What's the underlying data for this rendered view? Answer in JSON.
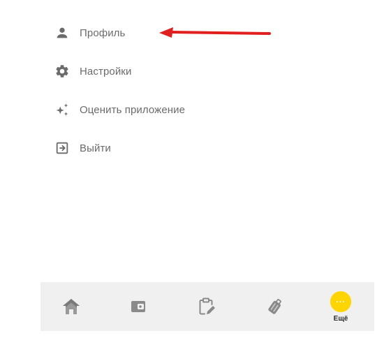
{
  "menu": {
    "items": [
      {
        "label": "Профиль",
        "icon": "person-icon"
      },
      {
        "label": "Настройки",
        "icon": "gear-icon"
      },
      {
        "label": "Оценить приложение",
        "icon": "sparkles-icon"
      },
      {
        "label": "Выйти",
        "icon": "exit-icon"
      }
    ]
  },
  "annotation": {
    "color": "#e11f1f",
    "points_to": "Профиль"
  },
  "bottom_nav": {
    "items": [
      {
        "icon": "home-icon"
      },
      {
        "icon": "wallet-icon"
      },
      {
        "icon": "clipboard-edit-icon"
      },
      {
        "icon": "luggage-icon"
      },
      {
        "icon": "more-icon",
        "label": "Ещё",
        "active": true,
        "accent": "#ffd500",
        "glyph": "···"
      }
    ]
  }
}
